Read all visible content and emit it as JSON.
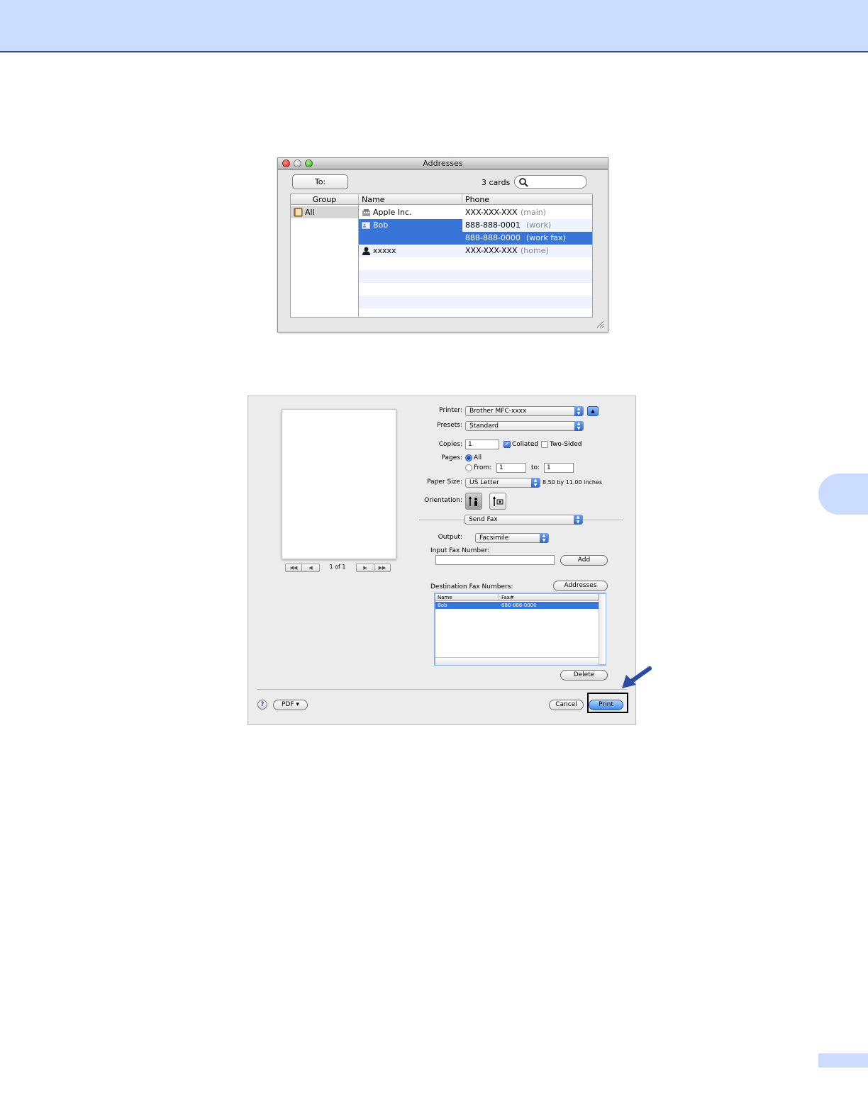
{
  "addresses": {
    "window_title": "Addresses",
    "to_button": "To:",
    "cards_count": "3 cards",
    "search_value": "",
    "columns": {
      "group": "Group",
      "name": "Name",
      "phone": "Phone"
    },
    "groups": [
      {
        "label": "All"
      }
    ],
    "rows": [
      {
        "name": "Apple Inc.",
        "phone": "XXX-XXX-XXX",
        "type": "(main)"
      },
      {
        "name": "Bob",
        "phone": "888-888-0001",
        "type": "(work)"
      },
      {
        "name": "",
        "phone": "888-888-0000",
        "type": "(work fax)"
      },
      {
        "name": "xxxxx",
        "phone": "XXX-XXX-XXX",
        "type": "(home)"
      }
    ]
  },
  "print": {
    "printer_label": "Printer:",
    "printer_value": "Brother MFC-xxxx",
    "presets_label": "Presets:",
    "presets_value": "Standard",
    "copies_label": "Copies:",
    "copies_value": "1",
    "collated_label": "Collated",
    "collated_checked": true,
    "two_sided_label": "Two-Sided",
    "two_sided_checked": false,
    "pages_label": "Pages:",
    "pages_all_label": "All",
    "pages_from_label": "From:",
    "pages_from_value": "1",
    "pages_to_label": "to:",
    "pages_to_value": "1",
    "paper_size_label": "Paper Size:",
    "paper_size_value": "US Letter",
    "paper_size_dims": "8.50 by 11.00 inches",
    "orientation_label": "Orientation:",
    "section_value": "Send Fax",
    "output_label": "Output:",
    "output_value": "Facsimile",
    "input_fax_label": "Input Fax Number:",
    "input_fax_value": "",
    "add_button": "Add",
    "destination_label": "Destination Fax Numbers:",
    "addresses_button": "Addresses",
    "dest_columns": {
      "name": "Name",
      "fax": "Fax#"
    },
    "dest_rows": [
      {
        "name": "Bob",
        "fax": "888-888-0000"
      }
    ],
    "delete_button": "Delete",
    "preview_page_text": "1 of 1",
    "pdf_button": "PDF ▾",
    "cancel_button": "Cancel",
    "print_button": "Print",
    "help_button": "?"
  },
  "colors": {
    "header_band": "#ccdcff",
    "selection": "#3875d7",
    "default_button": "#3f8ae8"
  }
}
